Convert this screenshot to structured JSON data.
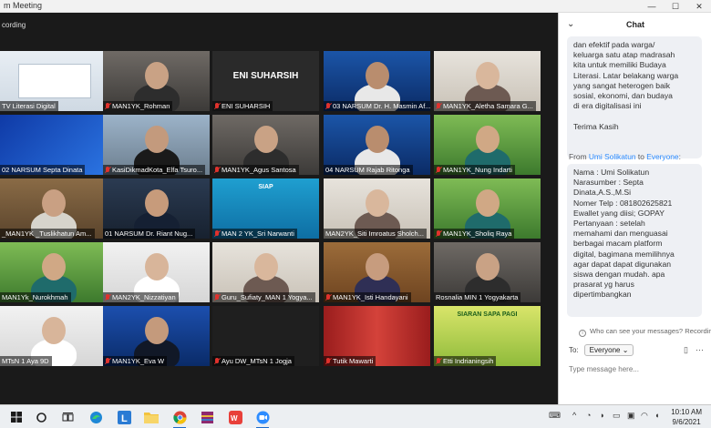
{
  "window": {
    "title": "m Meeting",
    "controls": [
      "—",
      "☐",
      "✕"
    ]
  },
  "meeting": {
    "recording_label": "cording",
    "tiles": [
      {
        "name": "TV Literasi Digital",
        "muted": false,
        "active": true,
        "video": "slide"
      },
      {
        "name": "MAN1YK_Rohman",
        "muted": true,
        "video": "person"
      },
      {
        "name": "ENI SUHARSIH",
        "muted": true,
        "video": "name-card",
        "card_text": "ENI SUHARSIH"
      },
      {
        "name": "03 NARSUM Dr. H. Masmin Af...",
        "muted": true,
        "video": "person-blue"
      },
      {
        "name": "MAN1YK_Aletha Samara G...",
        "muted": true,
        "video": "person-light"
      },
      {
        "name": "02 NARSUM Septa Dinata",
        "muted": false,
        "video": "blue-bg"
      },
      {
        "name": "KasiDikmadKota_Elfa Tsuro...",
        "muted": true,
        "video": "person-city"
      },
      {
        "name": "MAN1YK_Agus Santosa",
        "muted": true,
        "video": "person"
      },
      {
        "name": "04 NARSUM Rajab Ritonga",
        "muted": false,
        "video": "person-blue"
      },
      {
        "name": "MAN1YK_Nung Indarti",
        "muted": true,
        "video": "person-green"
      },
      {
        "name": "_MAN1YK _Tuslikhatun Am...",
        "muted": false,
        "video": "person-shelf"
      },
      {
        "name": "01 NARSUM Dr. Riant Nug...",
        "muted": false,
        "video": "person-suit"
      },
      {
        "name": "MAN 2 YK_Sri Narwanti",
        "muted": true,
        "video": "banner",
        "banner_text": "SIAP"
      },
      {
        "name": "MAN2YK_Siti Imroatus Sholch...",
        "muted": false,
        "video": "person-light"
      },
      {
        "name": "MAN1YK_Sholiq Raya",
        "muted": true,
        "video": "person-green"
      },
      {
        "name": "MAN1Yk_Nurokhmah",
        "muted": false,
        "video": "person-green"
      },
      {
        "name": "MAN2YK_Nizzatiyan",
        "muted": true,
        "video": "person-white"
      },
      {
        "name": "Guru_Sufiaty_MAN 1 Yogya...",
        "muted": true,
        "video": "person-light"
      },
      {
        "name": "MAN1YK_Isti Handayani",
        "muted": true,
        "video": "person-wood"
      },
      {
        "name": "Rosnalia MIN 1 Yogyakarta",
        "muted": false,
        "video": "person"
      },
      {
        "name": "MTsN 1 Aya 9D",
        "muted": false,
        "video": "person-white"
      },
      {
        "name": "MAN1YK_Eva W",
        "muted": true,
        "video": "person-suit-blue"
      },
      {
        "name": "Ayu DW_MTsN 1 Jogja",
        "muted": true,
        "video": "empty"
      },
      {
        "name": "Tutik Mawarti",
        "muted": true,
        "video": "red-curtain"
      },
      {
        "name": "Etti Indrianingsih",
        "muted": true,
        "video": "siaran",
        "banner_text": "SIARAN SAPA PAGI"
      }
    ]
  },
  "chat": {
    "title": "Chat",
    "message1_text": "dan efektif pada warga/\nkeluarga satu atap madrasah\nkita untuk memiliki Budaya\nLiterasi. Latar belakang warga\nyang sangat heterogen baik\nsosial, ekonomi, dan budaya\ndi era digitalisasi ini\n\nTerima Kasih",
    "message2_from_prefix": "From",
    "message2_sender": "Umi Solikatun",
    "message2_to": "to",
    "message2_recipient": "Everyone",
    "message2_separator": ":",
    "message2_text": "Nama : Umi Solikatun\nNarasumber : Septa\nDinata,A.S.,M.Si\nNomer Telp : 081802625821\nEwallet yang diisi; GOPAY\nPertanyaan : setelah\nmemahami dan menguasai\nberbagai macam platform\ndigital, bagimana memilihnya\nagar dapat dapat digunakan\nsiswa dengan mudah. apa\nprasarat yg harus\ndipertimbangkan",
    "who_can_see": "Who can see your messages? Recording O",
    "to_label": "To:",
    "to_value": "Everyone",
    "input_placeholder": "Type message here..."
  },
  "taskbar": {
    "apps": [
      "windows-start",
      "search",
      "task-view",
      "widgets",
      "edge",
      "learning-app",
      "file-explorer",
      "chrome",
      "winrar",
      "wps-office",
      "zoom"
    ],
    "tray_icons": [
      "keyboard",
      "chevron-up",
      "network",
      "volume",
      "battery",
      "display",
      "wifi",
      "speaker",
      "notifications"
    ],
    "time": "10:10 AM",
    "date": "9/6/2021"
  },
  "colors": {
    "accent": "#2d8cff",
    "active_speaker": "#8ad55a",
    "muted": "#e0322d"
  }
}
